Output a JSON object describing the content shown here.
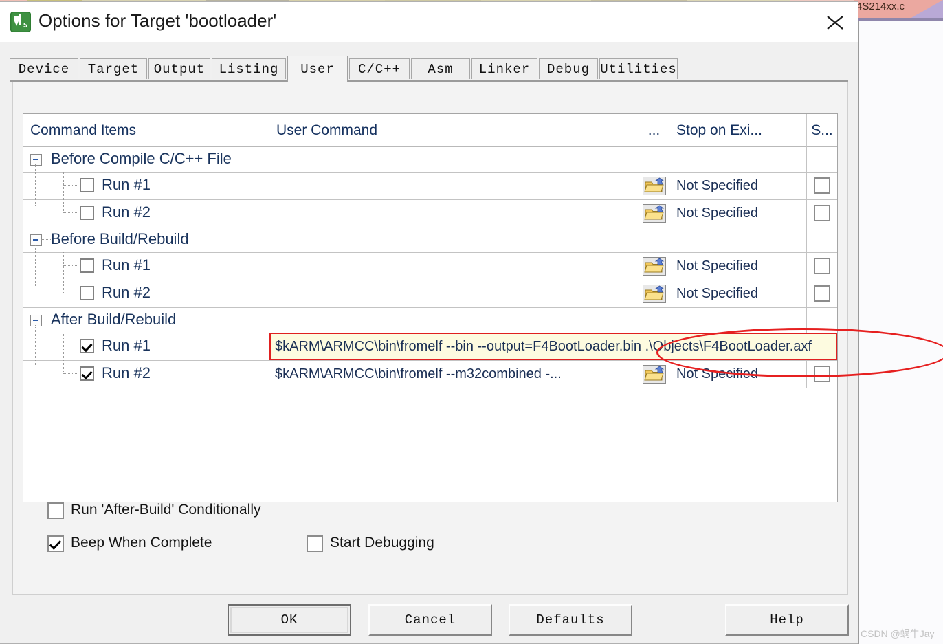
{
  "background": {
    "editor_tab_label": "4S214xx.c",
    "watermark": "CSDN @蜗牛Jay"
  },
  "dialog": {
    "title": "Options for Target 'bootloader'",
    "app_icon": "uvision5-icon",
    "close_icon": "close-icon"
  },
  "tabs": [
    {
      "label": "Device",
      "selected": false
    },
    {
      "label": "Target",
      "selected": false
    },
    {
      "label": "Output",
      "selected": false
    },
    {
      "label": "Listing",
      "selected": false
    },
    {
      "label": "User",
      "selected": true
    },
    {
      "label": "C/C++",
      "selected": false
    },
    {
      "label": "Asm",
      "selected": false
    },
    {
      "label": "Linker",
      "selected": false
    },
    {
      "label": "Debug",
      "selected": false
    },
    {
      "label": "Utilities",
      "selected": false
    }
  ],
  "grid": {
    "headers": [
      "Command Items",
      "User Command",
      "...",
      "Stop on Exi...",
      "S..."
    ],
    "rows": [
      {
        "kind": "group",
        "label": "Before Compile C/C++ File",
        "expanded": true,
        "command": "",
        "stop_on_exit": "",
        "has_browse": false,
        "has_stop_checkbox": false
      },
      {
        "kind": "item",
        "label": "Run #1",
        "checked": false,
        "command": "",
        "stop_on_exit": "Not Specified",
        "has_browse": true,
        "has_stop_checkbox": true
      },
      {
        "kind": "item",
        "label": "Run #2",
        "checked": false,
        "command": "",
        "stop_on_exit": "Not Specified",
        "has_browse": true,
        "has_stop_checkbox": true
      },
      {
        "kind": "group",
        "label": "Before Build/Rebuild",
        "expanded": true,
        "command": "",
        "stop_on_exit": "",
        "has_browse": false,
        "has_stop_checkbox": false
      },
      {
        "kind": "item",
        "label": "Run #1",
        "checked": false,
        "command": "",
        "stop_on_exit": "Not Specified",
        "has_browse": true,
        "has_stop_checkbox": true
      },
      {
        "kind": "item",
        "label": "Run #2",
        "checked": false,
        "command": "",
        "stop_on_exit": "Not Specified",
        "has_browse": true,
        "has_stop_checkbox": true
      },
      {
        "kind": "group",
        "label": "After Build/Rebuild",
        "expanded": true,
        "command": "",
        "stop_on_exit": "",
        "has_browse": false,
        "has_stop_checkbox": false
      },
      {
        "kind": "item",
        "label": "Run #1",
        "checked": true,
        "editing": true,
        "command": "$kARM\\ARMCC\\bin\\fromelf --bin --output=F4BootLoader.bin .\\Objects\\F4BootLoader.axf",
        "stop_on_exit": "",
        "has_browse": false,
        "has_stop_checkbox": false
      },
      {
        "kind": "item",
        "label": "Run #2",
        "checked": true,
        "command": "$kARM\\ARMCC\\bin\\fromelf --m32combined  -...",
        "stop_on_exit": "Not Specified",
        "has_browse": true,
        "has_stop_checkbox": true
      }
    ]
  },
  "options": {
    "run_after_build_conditionally": {
      "label": "Run 'After-Build' Conditionally",
      "checked": false
    },
    "beep_when_complete": {
      "label": "Beep When Complete",
      "checked": true
    },
    "start_debugging": {
      "label": "Start Debugging",
      "checked": false
    }
  },
  "buttons": {
    "ok": "OK",
    "cancel": "Cancel",
    "defaults": "Defaults",
    "help": "Help"
  },
  "annotation": {
    "highlight_color": "#e62020",
    "edit_cell_bg": "#fdfbe0"
  }
}
